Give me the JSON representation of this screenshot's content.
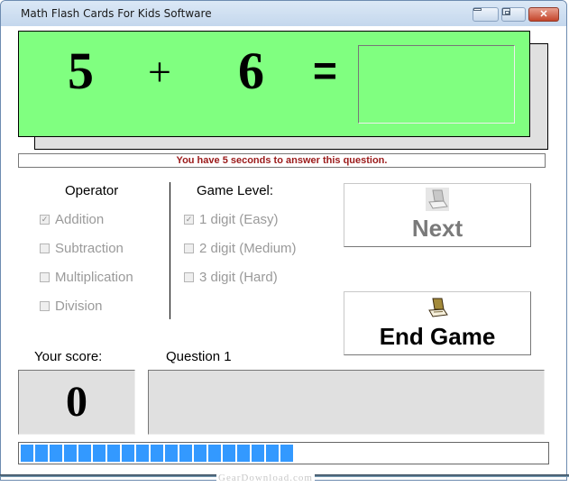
{
  "window": {
    "title": "Math Flash Cards For Kids Software",
    "controls": {
      "minimize": "minimize",
      "maximize": "maximize",
      "close": "✕"
    }
  },
  "card": {
    "operand1": "5",
    "operator": "+",
    "operand2": "6",
    "equals": "=",
    "answer_value": "",
    "background": "#80ff80"
  },
  "status": {
    "message": "You have 5 seconds to answer this question.",
    "color": "#9b1a1a"
  },
  "operator_group": {
    "title": "Operator",
    "options": [
      {
        "label": "Addition",
        "checked": true
      },
      {
        "label": "Subtraction",
        "checked": false
      },
      {
        "label": "Multiplication",
        "checked": false
      },
      {
        "label": "Division",
        "checked": false
      }
    ]
  },
  "level_group": {
    "title": "Game Level:",
    "options": [
      {
        "label": "1 digit (Easy)",
        "checked": true
      },
      {
        "label": "2 digit (Medium)",
        "checked": false
      },
      {
        "label": "3 digit (Hard)",
        "checked": false
      }
    ]
  },
  "buttons": {
    "next": {
      "label": "Next",
      "icon": "laptop-icon",
      "enabled": false
    },
    "end_game": {
      "label": "End Game",
      "icon": "laptop-icon",
      "enabled": true
    }
  },
  "score": {
    "label": "Your score:",
    "value": "0"
  },
  "question": {
    "label": "Question 1",
    "text": ""
  },
  "progress": {
    "segments_filled": 19,
    "fraction": 0.52,
    "color": "#3399ff"
  },
  "watermark": "GearDownload.com"
}
